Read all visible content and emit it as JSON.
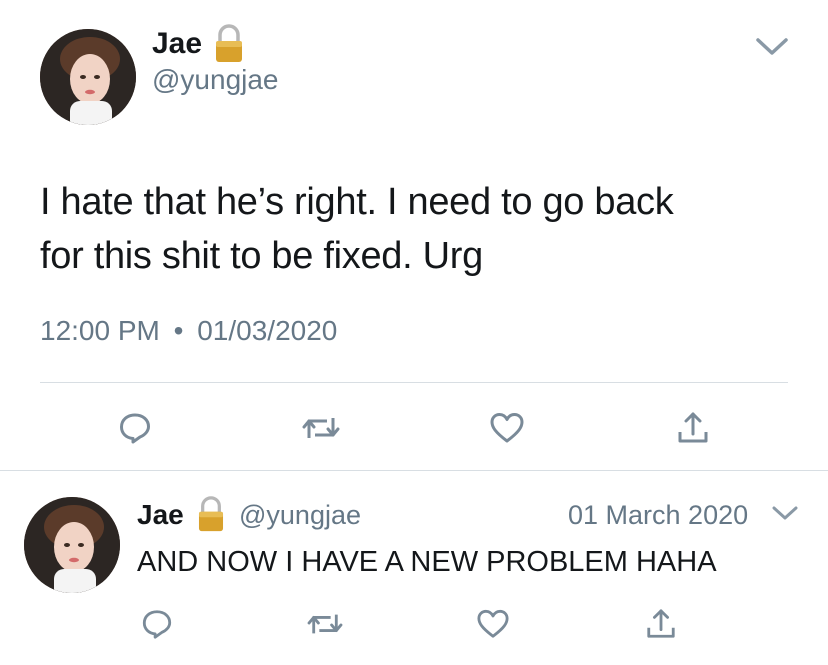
{
  "main_tweet": {
    "author_name": "Jae",
    "author_handle": "@yungjae",
    "text_line1": "I hate that he’s right. I need to go back",
    "text_line2": "for this shit to be fixed. Urg",
    "time": "12:00 PM",
    "separator": "•",
    "date": "01/03/2020"
  },
  "reply_tweet": {
    "author_name": "Jae",
    "author_handle": "@yungjae",
    "date": "01 March 2020",
    "text": "AND NOW I HAVE A NEW PROBLEM HAHA"
  },
  "icons": {
    "lock": "lock-icon",
    "chevron": "chevron-down-icon",
    "reply": "reply-icon",
    "retweet": "retweet-icon",
    "like": "like-icon",
    "share": "share-icon"
  },
  "colors": {
    "text": "#14171a",
    "secondary": "#657786",
    "icon": "#7a8a98",
    "divider": "#d8dee3"
  }
}
